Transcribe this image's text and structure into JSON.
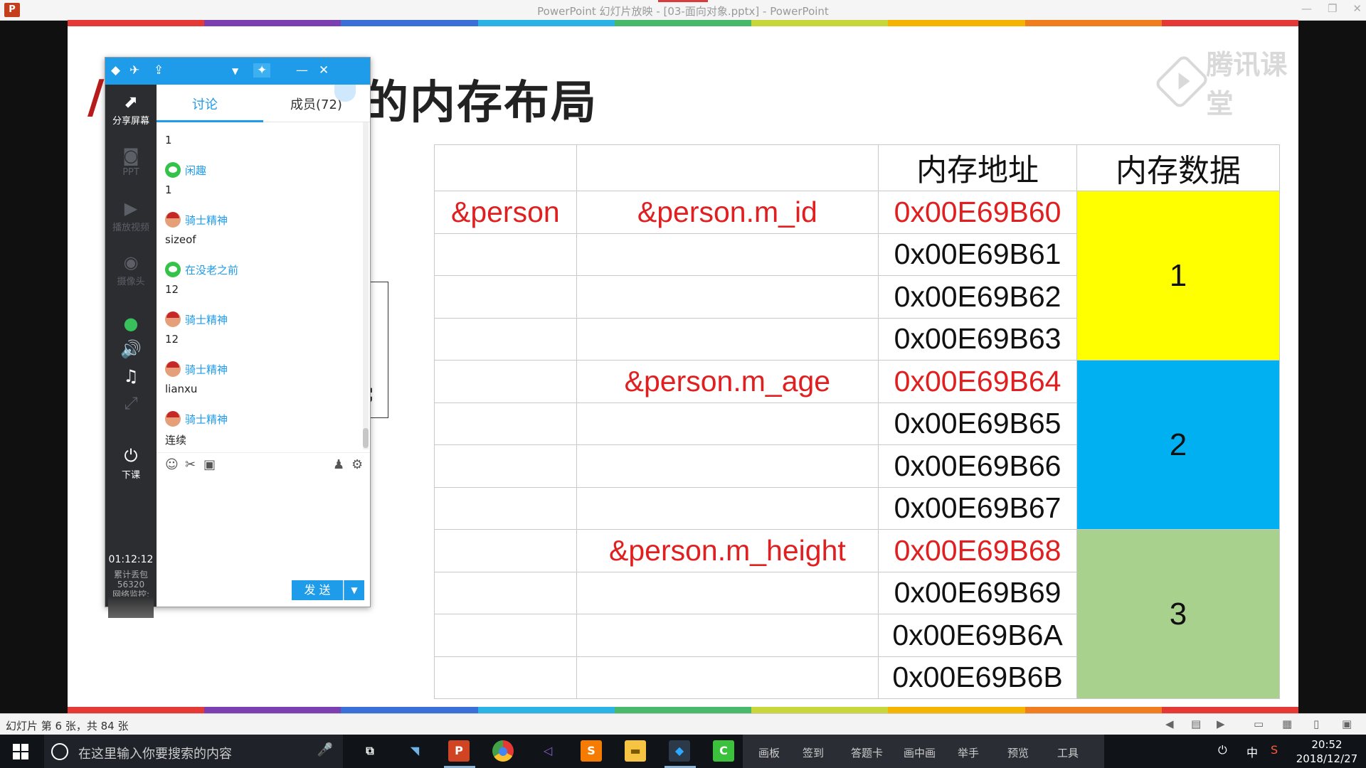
{
  "window": {
    "title": "PowerPoint 幻灯片放映 - [03-面向对象.pptx] - PowerPoint",
    "app_icon": "P"
  },
  "slide": {
    "title": "的内存布局",
    "watermark": "腾讯课堂",
    "rainbow": [
      "#e53935",
      "#7b3fb2",
      "#3a6fd8",
      "#2bb3e6",
      "#48b96b",
      "#c6d63b",
      "#f5b400",
      "#f07d1e",
      "#e53935"
    ],
    "table": {
      "header": [
        "",
        "",
        "内存地址",
        "内存数据"
      ],
      "rows": [
        {
          "var": "&person",
          "member": "&person.m_id",
          "addr": "0x00E69B60",
          "addr_red": true
        },
        {
          "var": "",
          "member": "",
          "addr": "0x00E69B61",
          "addr_red": false
        },
        {
          "var": "",
          "member": "",
          "addr": "0x00E69B62",
          "addr_red": false
        },
        {
          "var": "",
          "member": "",
          "addr": "0x00E69B63",
          "addr_red": false
        },
        {
          "var": "",
          "member": "&person.m_age",
          "addr": "0x00E69B64",
          "addr_red": true
        },
        {
          "var": "",
          "member": "",
          "addr": "0x00E69B65",
          "addr_red": false
        },
        {
          "var": "",
          "member": "",
          "addr": "0x00E69B66",
          "addr_red": false
        },
        {
          "var": "",
          "member": "",
          "addr": "0x00E69B67",
          "addr_red": false
        },
        {
          "var": "",
          "member": "&person.m_height",
          "addr": "0x00E69B68",
          "addr_red": true
        },
        {
          "var": "",
          "member": "",
          "addr": "0x00E69B69",
          "addr_red": false
        },
        {
          "var": "",
          "member": "",
          "addr": "0x00E69B6A",
          "addr_red": false
        },
        {
          "var": "",
          "member": "",
          "addr": "0x00E69B6B",
          "addr_red": false
        }
      ],
      "data_blocks": [
        {
          "value": "1",
          "color": "#ffff00"
        },
        {
          "value": "2",
          "color": "#00b0f0"
        },
        {
          "value": "3",
          "color": "#a9d18e"
        }
      ]
    }
  },
  "chat": {
    "side": {
      "share": "分享屏幕",
      "ppt": "PPT",
      "video": "播放视频",
      "camera": "摄像头",
      "end": "下课",
      "timer": "01:12:12",
      "loss_label": "累计丢包",
      "loss_value": "56320",
      "net": "网络监控:"
    },
    "tabs": {
      "discuss": "讨论",
      "members": "成员(72)"
    },
    "messages": [
      {
        "text": "1"
      },
      {
        "name": "闲趣",
        "avatar": "wechat",
        "text": "1"
      },
      {
        "name": "骑士精神",
        "avatar": "knight",
        "text": "sizeof"
      },
      {
        "name": "在没老之前",
        "avatar": "wechat",
        "text": "12"
      },
      {
        "name": "骑士精神",
        "avatar": "knight",
        "text": "12"
      },
      {
        "name": "骑士精神",
        "avatar": "knight",
        "text": "lianxu"
      },
      {
        "name": "骑士精神",
        "avatar": "knight",
        "text": "连续"
      }
    ],
    "send": "发 送"
  },
  "status": {
    "slide_info": "幻灯片 第 6 张，共 84 张"
  },
  "taskbar": {
    "search_placeholder": "在这里输入你要搜索的内容",
    "menu": [
      "画板",
      "签到",
      "答题卡",
      "画中画",
      "举手",
      "预览",
      "工具"
    ],
    "ime": "中",
    "time": "20:52",
    "date": "2018/12/27"
  }
}
